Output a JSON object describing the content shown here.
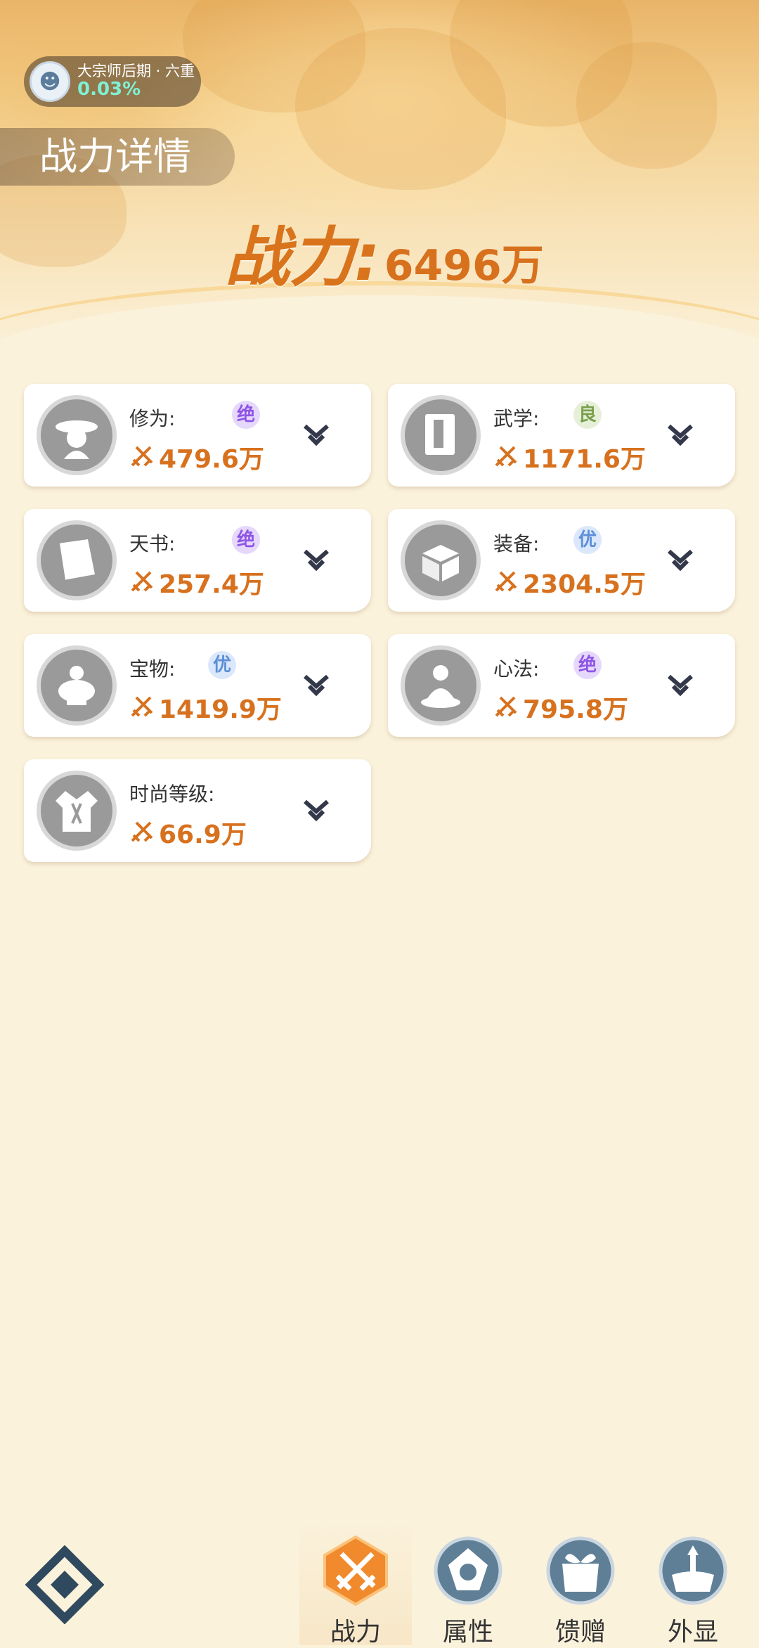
{
  "profile": {
    "title": "大宗师后期 · 六重",
    "progress": "0.03%"
  },
  "page_title": "战力详情",
  "total_power": {
    "label": "战力:",
    "value": "6496万"
  },
  "categories": [
    {
      "name": "修为:",
      "grade": "绝",
      "value": "479.6万",
      "icon": "hermit-icon"
    },
    {
      "name": "武学:",
      "grade": "良",
      "value": "1171.6万",
      "icon": "book-icon"
    },
    {
      "name": "天书:",
      "grade": "绝",
      "value": "257.4万",
      "icon": "scroll-book-icon"
    },
    {
      "name": "装备:",
      "grade": "优",
      "value": "2304.5万",
      "icon": "equipment-box-icon"
    },
    {
      "name": "宝物:",
      "grade": "优",
      "value": "1419.9万",
      "icon": "treasure-pot-icon"
    },
    {
      "name": "心法:",
      "grade": "绝",
      "value": "795.8万",
      "icon": "meditation-icon"
    },
    {
      "name": "时尚等级:",
      "grade": "",
      "value": "66.9万",
      "icon": "costume-icon"
    }
  ],
  "tabs": [
    {
      "label": "战力",
      "active": true
    },
    {
      "label": "属性",
      "active": false
    },
    {
      "label": "馈赠",
      "active": false
    },
    {
      "label": "外显",
      "active": false
    }
  ],
  "colors": {
    "accent": "#d7711e",
    "grade_jue": "#8f55e6",
    "grade_you": "#5d8fd8",
    "grade_liang": "#7aa04d"
  }
}
